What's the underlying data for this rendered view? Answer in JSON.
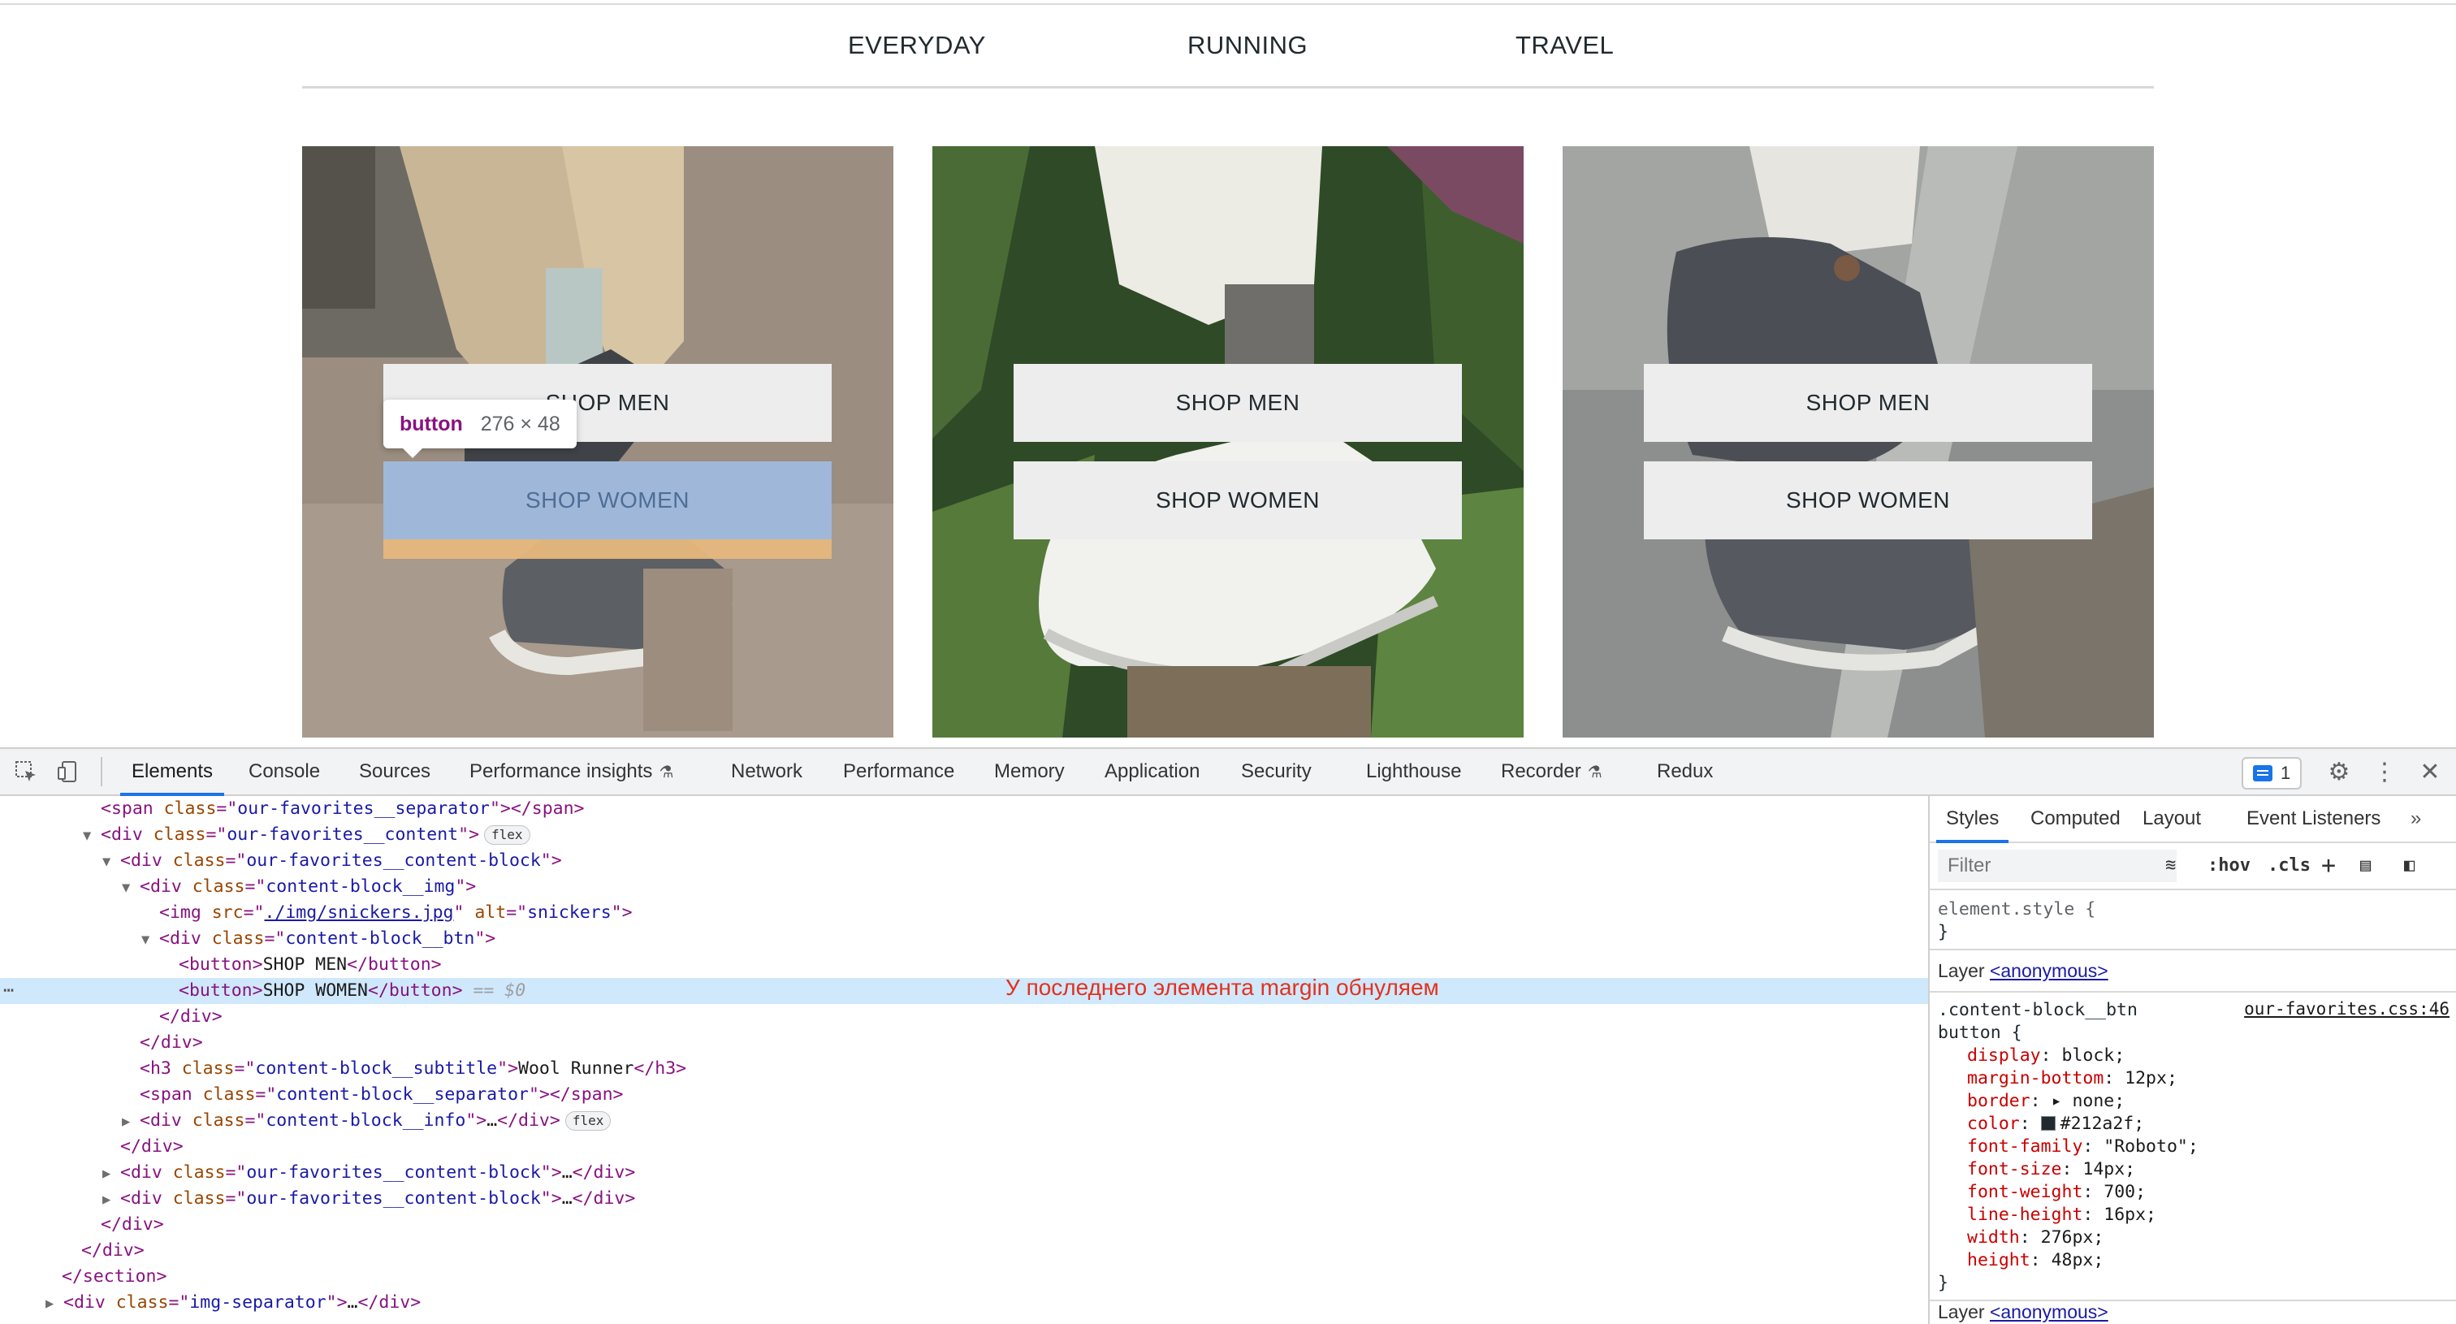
{
  "category_nav": {
    "tabs": [
      {
        "label": "EVERYDAY"
      },
      {
        "label": "RUNNING"
      },
      {
        "label": "TRAVEL"
      }
    ]
  },
  "cards": [
    {
      "image": "shoe-photo-men-stone-step",
      "shop_men": "SHOP MEN",
      "shop_women": "SHOP WOMEN",
      "women_inspected": true
    },
    {
      "image": "shoe-photo-white-runner-leaves",
      "shop_men": "SHOP MEN",
      "shop_women": "SHOP WOMEN",
      "women_inspected": false
    },
    {
      "image": "shoe-photo-grey-wool-stairs",
      "shop_men": "SHOP MEN",
      "shop_women": "SHOP WOMEN",
      "women_inspected": false
    }
  ],
  "inspect_tooltip": {
    "tag": "button",
    "size": "276 × 48"
  },
  "devtools": {
    "tabs": [
      {
        "label": "Elements",
        "active": true
      },
      {
        "label": "Console"
      },
      {
        "label": "Sources"
      },
      {
        "label": "Performance insights",
        "icon": "flask-icon"
      },
      {
        "label": "Network"
      },
      {
        "label": "Performance"
      },
      {
        "label": "Memory"
      },
      {
        "label": "Application"
      },
      {
        "label": "Security"
      },
      {
        "label": "Lighthouse"
      },
      {
        "label": "Recorder",
        "icon": "flask-icon"
      },
      {
        "label": "Redux"
      }
    ],
    "issues_count": "1",
    "elements_annotation": "У последнего элемента margin обнуляем",
    "dom": {
      "l1_class": "our-favorites__separator",
      "l2_class": "our-favorites__content",
      "l2_badge": "flex",
      "l3_class": "our-favorites__content-block",
      "l4_class": "content-block__img",
      "l5_src": "./img/snickers.jpg",
      "l5_alt": "snickers",
      "l6_class": "content-block__btn",
      "l7_text": "SHOP MEN",
      "l8_text": "SHOP WOMEN",
      "l8_eq": "== $0",
      "l11_class": "content-block__subtitle",
      "l11_text": "Wool Runner",
      "l12_class": "content-block__separator",
      "l13_class": "content-block__info",
      "l13_badge": "flex",
      "l15_class": "our-favorites__content-block",
      "l16_class": "our-favorites__content-block",
      "l20_class": "img-separator"
    },
    "styles_panel": {
      "tabs": [
        {
          "label": "Styles",
          "active": true
        },
        {
          "label": "Computed"
        },
        {
          "label": "Layout"
        },
        {
          "label": "Event Listeners"
        }
      ],
      "filter_placeholder": "Filter",
      "hov_label": ":hov",
      "cls_label": ".cls",
      "element_style": "element.style {",
      "close_brace": "}",
      "layer_label": "Layer",
      "layer_link": "<anonymous>",
      "rule_selector_1": ".content-block__btn",
      "rule_selector_2": "button {",
      "rule_source": "our-favorites.css:46",
      "color_hex": "#212a2f",
      "declarations": [
        {
          "prop": "display",
          "value": "block;"
        },
        {
          "prop": "margin-bottom",
          "value": "12px;"
        },
        {
          "prop": "border",
          "value": "▸ none;"
        },
        {
          "prop": "color",
          "value": "#212a2f;"
        },
        {
          "prop": "font-family",
          "value": "\"Roboto\";"
        },
        {
          "prop": "font-size",
          "value": "14px;"
        },
        {
          "prop": "font-weight",
          "value": "700;"
        },
        {
          "prop": "line-height",
          "value": "16px;"
        },
        {
          "prop": "width",
          "value": "276px;"
        },
        {
          "prop": "height",
          "value": "48px;"
        }
      ]
    }
  }
}
